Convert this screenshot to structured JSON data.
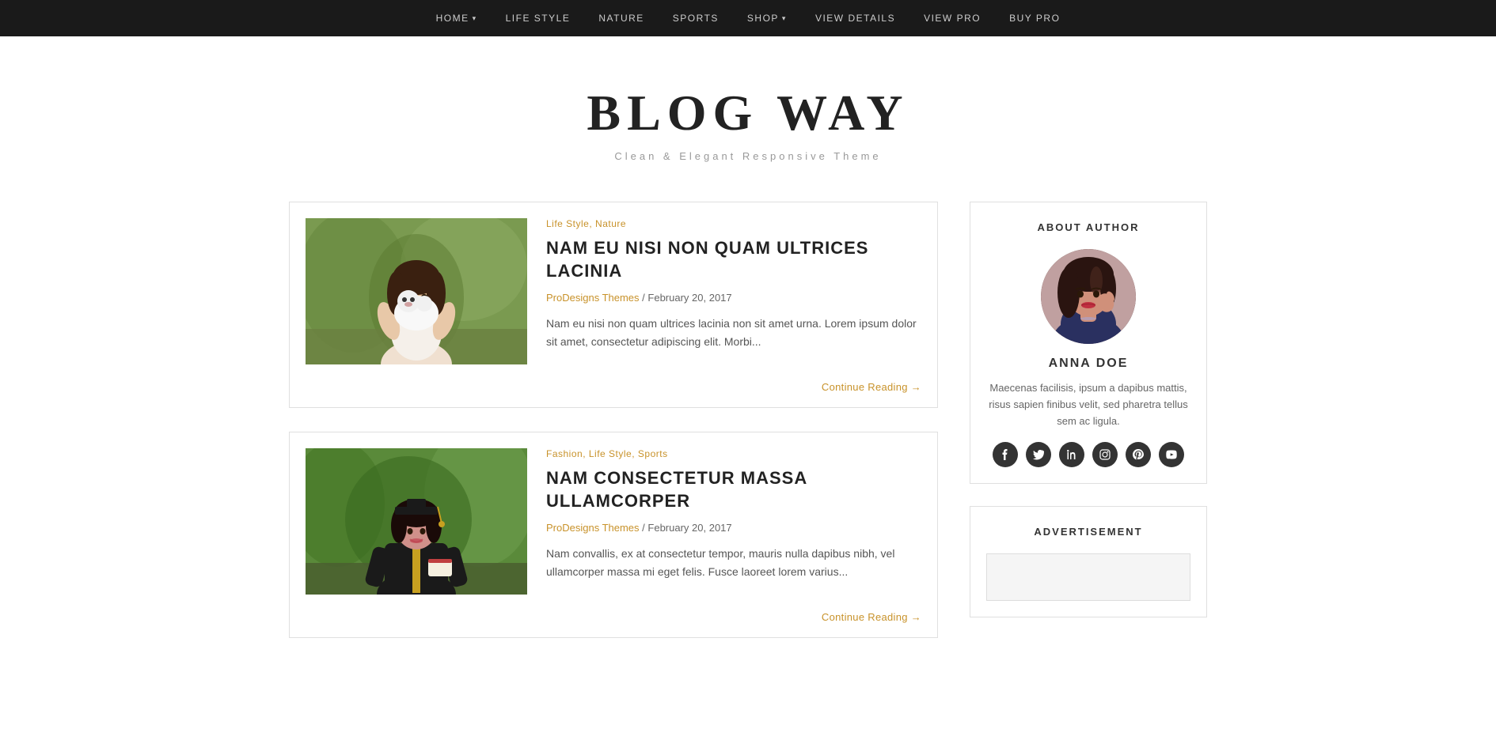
{
  "nav": {
    "items": [
      {
        "label": "HOME",
        "hasDropdown": true,
        "name": "home"
      },
      {
        "label": "LIFE STYLE",
        "hasDropdown": false,
        "name": "life-style"
      },
      {
        "label": "NATURE",
        "hasDropdown": false,
        "name": "nature"
      },
      {
        "label": "SPORTS",
        "hasDropdown": false,
        "name": "sports"
      },
      {
        "label": "SHOP",
        "hasDropdown": true,
        "name": "shop"
      },
      {
        "label": "VIEW DETAILS",
        "hasDropdown": false,
        "name": "view-details"
      },
      {
        "label": "VIEW PRO",
        "hasDropdown": false,
        "name": "view-pro"
      },
      {
        "label": "BUY PRO",
        "hasDropdown": false,
        "name": "buy-pro"
      }
    ]
  },
  "site": {
    "title": "BLOG WAY",
    "tagline": "Clean & Elegant Responsive Theme"
  },
  "articles": [
    {
      "id": "article-1",
      "categories": "Life Style, Nature",
      "title": "NAM EU NISI NON QUAM ULTRICES LACINIA",
      "author": "ProDesigns Themes",
      "date": "February 20, 2017",
      "excerpt": "Nam eu nisi non quam ultrices lacinia non sit amet urna. Lorem ipsum dolor sit amet, consectetur adipiscing elit. Morbi...",
      "continue_label": "Continue Reading →",
      "image_type": "lady-dog"
    },
    {
      "id": "article-2",
      "categories": "Fashion, Life Style, Sports",
      "title": "NAM CONSECTETUR MASSA ULLAMCORPER",
      "author": "ProDesigns Themes",
      "date": "February 20, 2017",
      "excerpt": "Nam convallis, ex at consectetur tempor, mauris nulla dapibus nibh, vel ullamcorper massa mi eget felis. Fusce laoreet lorem varius...",
      "continue_label": "Continue Reading →",
      "image_type": "graduate"
    }
  ],
  "sidebar": {
    "about_widget": {
      "title": "ABOUT AUTHOR",
      "author_name": "ANNA DOE",
      "author_bio": "Maecenas facilisis, ipsum a dapibus mattis, risus sapien finibus velit, sed pharetra tellus sem ac ligula.",
      "social_icons": [
        {
          "name": "facebook-icon",
          "symbol": "f"
        },
        {
          "name": "twitter-icon",
          "symbol": "t"
        },
        {
          "name": "linkedin-icon",
          "symbol": "in"
        },
        {
          "name": "instagram-icon",
          "symbol": "ig"
        },
        {
          "name": "pinterest-icon",
          "symbol": "p"
        },
        {
          "name": "youtube-icon",
          "symbol": "▶"
        }
      ]
    },
    "ad_widget": {
      "title": "ADVERTISEMENT"
    }
  }
}
